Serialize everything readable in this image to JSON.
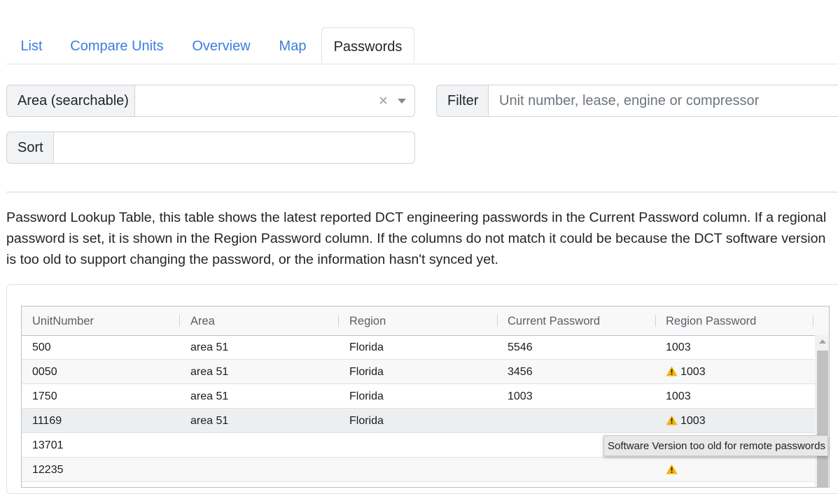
{
  "tabs": [
    {
      "label": "List",
      "active": false
    },
    {
      "label": "Compare Units",
      "active": false
    },
    {
      "label": "Overview",
      "active": false
    },
    {
      "label": "Map",
      "active": false
    },
    {
      "label": "Passwords",
      "active": true
    }
  ],
  "filters": {
    "area_label": "Area (searchable)",
    "area_value": "",
    "area_clear": "×",
    "filter_label": "Filter",
    "filter_placeholder": "Unit number, lease, engine or compressor",
    "sort_label": "Sort",
    "sort_value": ""
  },
  "description": "Password Lookup Table, this table shows the latest reported DCT engineering passwords in the Current Password column. If a regional password is set, it is shown in the Region Password column. If the columns do not match it could be because the DCT software version is too old to support changing the password, or the information hasn't synced yet.",
  "table": {
    "columns": [
      "UnitNumber",
      "Area",
      "Region",
      "Current Password",
      "Region Password"
    ],
    "rows": [
      {
        "unit": "500",
        "area": "area 51",
        "region": "Florida",
        "current": "5546",
        "region_pw": "1003",
        "warning": false
      },
      {
        "unit": "0050",
        "area": "area 51",
        "region": "Florida",
        "current": "3456",
        "region_pw": "1003",
        "warning": true
      },
      {
        "unit": "1750",
        "area": "area 51",
        "region": "Florida",
        "current": "1003",
        "region_pw": "1003",
        "warning": false
      },
      {
        "unit": "11169",
        "area": "area 51",
        "region": "Florida",
        "current": "",
        "region_pw": "1003",
        "warning": true
      },
      {
        "unit": "13701",
        "area": "",
        "region": "",
        "current": "",
        "region_pw": "",
        "warning": false
      },
      {
        "unit": "12235",
        "area": "",
        "region": "",
        "current": "",
        "region_pw": "",
        "warning": true
      }
    ]
  },
  "tooltip": "Software Version too old for remote passwords",
  "icons": {
    "warning": "warning-triangle-icon",
    "clear": "close-icon",
    "dropdown": "chevron-down-icon",
    "scroll_up": "scroll-up-arrow-icon"
  },
  "colors": {
    "link": "#3b7ddd",
    "warning": "#f5b400"
  }
}
